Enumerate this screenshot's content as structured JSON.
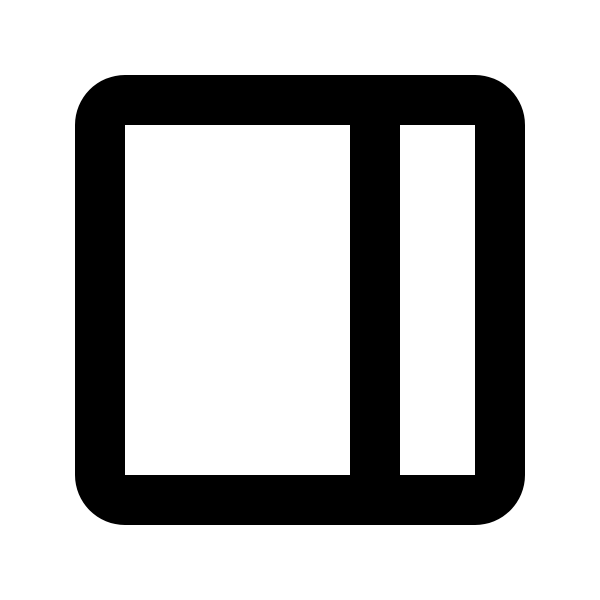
{
  "icon": {
    "name": "sidebar-right-panel-icon",
    "stroke_color": "#000000",
    "background_color": "#ffffff"
  }
}
